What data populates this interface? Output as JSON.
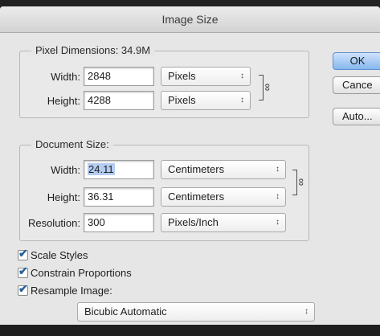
{
  "window": {
    "title": "Image Size"
  },
  "pixel_dimensions": {
    "legend": "Pixel Dimensions: 34.9M",
    "width_label": "Width:",
    "width_value": "2848",
    "width_unit": "Pixels",
    "height_label": "Height:",
    "height_value": "4288",
    "height_unit": "Pixels"
  },
  "document_size": {
    "legend": "Document Size:",
    "width_label": "Width:",
    "width_value": "24.11",
    "width_unit": "Centimeters",
    "height_label": "Height:",
    "height_value": "36.31",
    "height_unit": "Centimeters",
    "resolution_label": "Resolution:",
    "resolution_value": "300",
    "resolution_unit": "Pixels/Inch"
  },
  "options": {
    "scale_styles": {
      "label": "Scale Styles",
      "checked": true
    },
    "constrain_proportions": {
      "label": "Constrain Proportions",
      "checked": true
    },
    "resample_image": {
      "label": "Resample Image:",
      "checked": true
    },
    "resample_method": "Bicubic Automatic"
  },
  "buttons": {
    "ok": "OK",
    "cancel": "Cance",
    "auto": "Auto..."
  },
  "glyphs": {
    "select_arrows": "↕",
    "link": "∞",
    "check": "✔"
  },
  "colors": {
    "default_button": "#86b6ef",
    "selection": "#b4cdf2",
    "check": "#26609e"
  }
}
